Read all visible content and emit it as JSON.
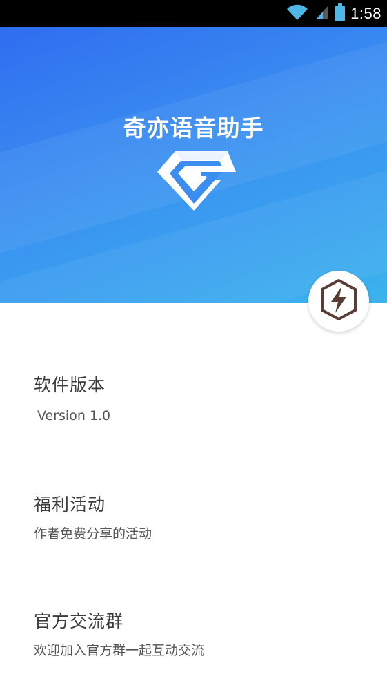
{
  "status_bar": {
    "time": "1:58",
    "icons": [
      "wifi-icon",
      "cell-signal-icon",
      "battery-icon"
    ]
  },
  "header": {
    "title": "奇亦语音助手",
    "logo_icon": "app-logo-g-icon",
    "action_icon": "lightning-bolt-icon",
    "colors": {
      "gradient_start": "#2f6df0",
      "gradient_end": "#3bb3ee",
      "action_icon": "#5a3e36"
    }
  },
  "sections": {
    "version": {
      "title": "软件版本",
      "subtitle": "Version 1.0"
    },
    "welfare": {
      "title": "福利活动",
      "subtitle": "作者免费分享的活动"
    },
    "group": {
      "title": "官方交流群",
      "subtitle": "欢迎加入官方群一起互动交流"
    }
  }
}
